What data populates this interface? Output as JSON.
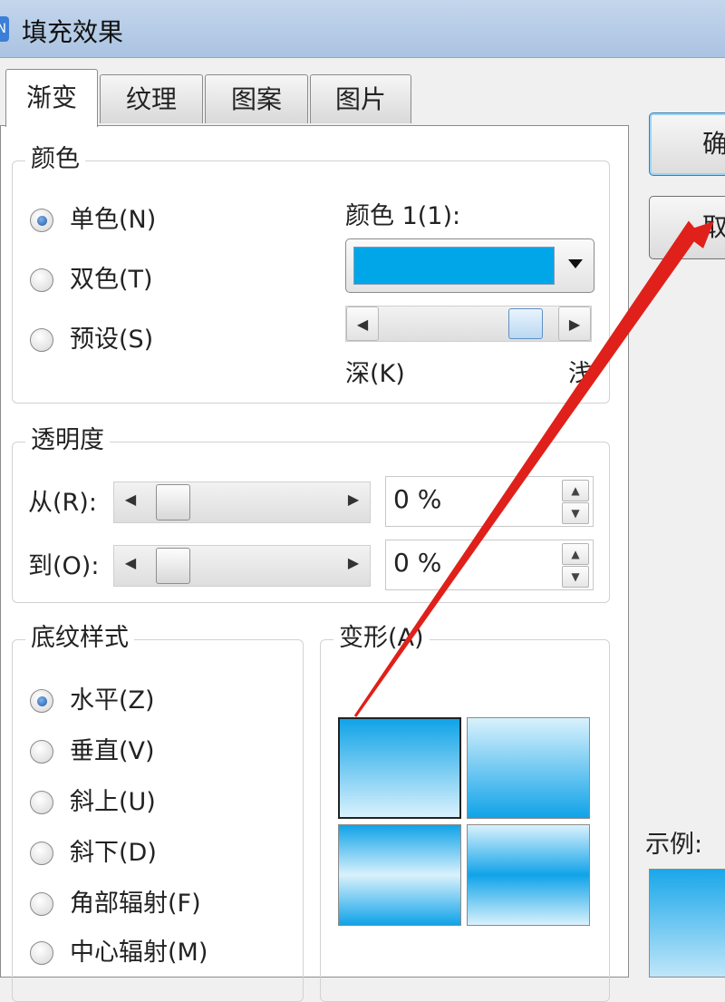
{
  "window": {
    "title": "填充效果",
    "icon_glyph": "N"
  },
  "tabs": [
    {
      "label": "渐变",
      "active": true
    },
    {
      "label": "纹理",
      "active": false
    },
    {
      "label": "图案",
      "active": false
    },
    {
      "label": "图片",
      "active": false
    }
  ],
  "color_group": {
    "legend": "颜色",
    "options": [
      {
        "label": "单色(N)",
        "checked": true
      },
      {
        "label": "双色(T)",
        "checked": false
      },
      {
        "label": "预设(S)",
        "checked": false
      }
    ],
    "color1_label": "颜色 1(1):",
    "color1_value": "#00a6e8",
    "shade_dark_label": "深(K)",
    "shade_light_label": "浅",
    "shade_level": 0.88
  },
  "transparency": {
    "legend": "透明度",
    "from_label": "从(R):",
    "from_value": "0 %",
    "to_label": "到(O):",
    "to_value": "0 %"
  },
  "shading_styles": {
    "legend": "底纹样式",
    "options": [
      {
        "label": "水平(Z)",
        "checked": true
      },
      {
        "label": "垂直(V)",
        "checked": false
      },
      {
        "label": "斜上(U)",
        "checked": false
      },
      {
        "label": "斜下(D)",
        "checked": false
      },
      {
        "label": "角部辐射(F)",
        "checked": false
      },
      {
        "label": "中心辐射(M)",
        "checked": false
      }
    ]
  },
  "variants": {
    "legend": "变形(A)"
  },
  "buttons": {
    "ok": "确",
    "cancel": "取"
  },
  "sample_label": "示例:",
  "annotation": {
    "arrow_color": "#e0201a"
  }
}
